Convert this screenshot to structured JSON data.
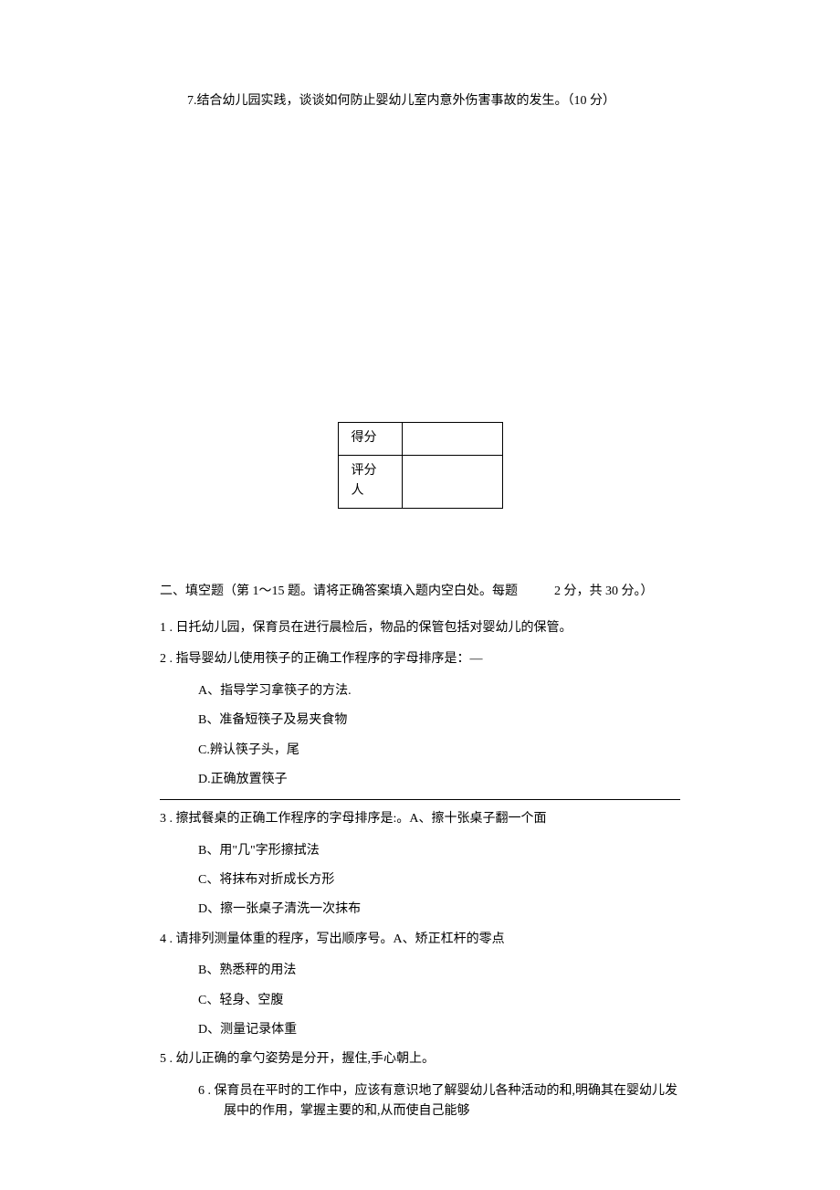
{
  "q7_text": "7.结合幼儿园实践，谈谈如何防止婴幼儿室内意外伤害事故的发生。（10 分）",
  "score_table": {
    "row1_label": "得分",
    "row2_label": "评分人"
  },
  "section2_title_prefix": "二、填空题（第 1～15 题。请将正确答案填入题内空白处。每题",
  "section2_title_suffix": "2 分，共 30 分。）",
  "q1": "1 . 日托幼儿园，保育员在进行晨检后，物品的保管包括对婴幼儿的保管。",
  "q2_stem": "2 . 指导婴幼儿使用筷子的正确工作程序的字母排序是：—",
  "q2_a": "A、指导学习拿筷子的方法.",
  "q2_b": "B、准备短筷子及易夹食物",
  "q2_c": "C.辨认筷子头，尾",
  "q2_d": "D.正确放置筷子",
  "q3_stem": "3 . 擦拭餐桌的正确工作程序的字母排序是:。A、擦十张桌子翻一个面",
  "q3_b": "B、用\"几\"字形擦拭法",
  "q3_c": "C、将抹布对折成长方形",
  "q3_d": "D、擦一张桌子清洗一次抹布",
  "q4_stem": "4 . 请排列测量体重的程序，写出顺序号。A、矫正杠杆的零点",
  "q4_b": "B、熟悉秤的用法",
  "q4_c": "C、轻身、空腹",
  "q4_d": "D、测量记录体重",
  "q5": "5 . 幼儿正确的拿勺姿势是分开，握住,手心朝上。",
  "q6": "6 . 保育员在平时的工作中，应该有意识地了解婴幼儿各种活动的和,明确其在婴幼儿发展中的作用，掌握主要的和,从而使自己能够"
}
